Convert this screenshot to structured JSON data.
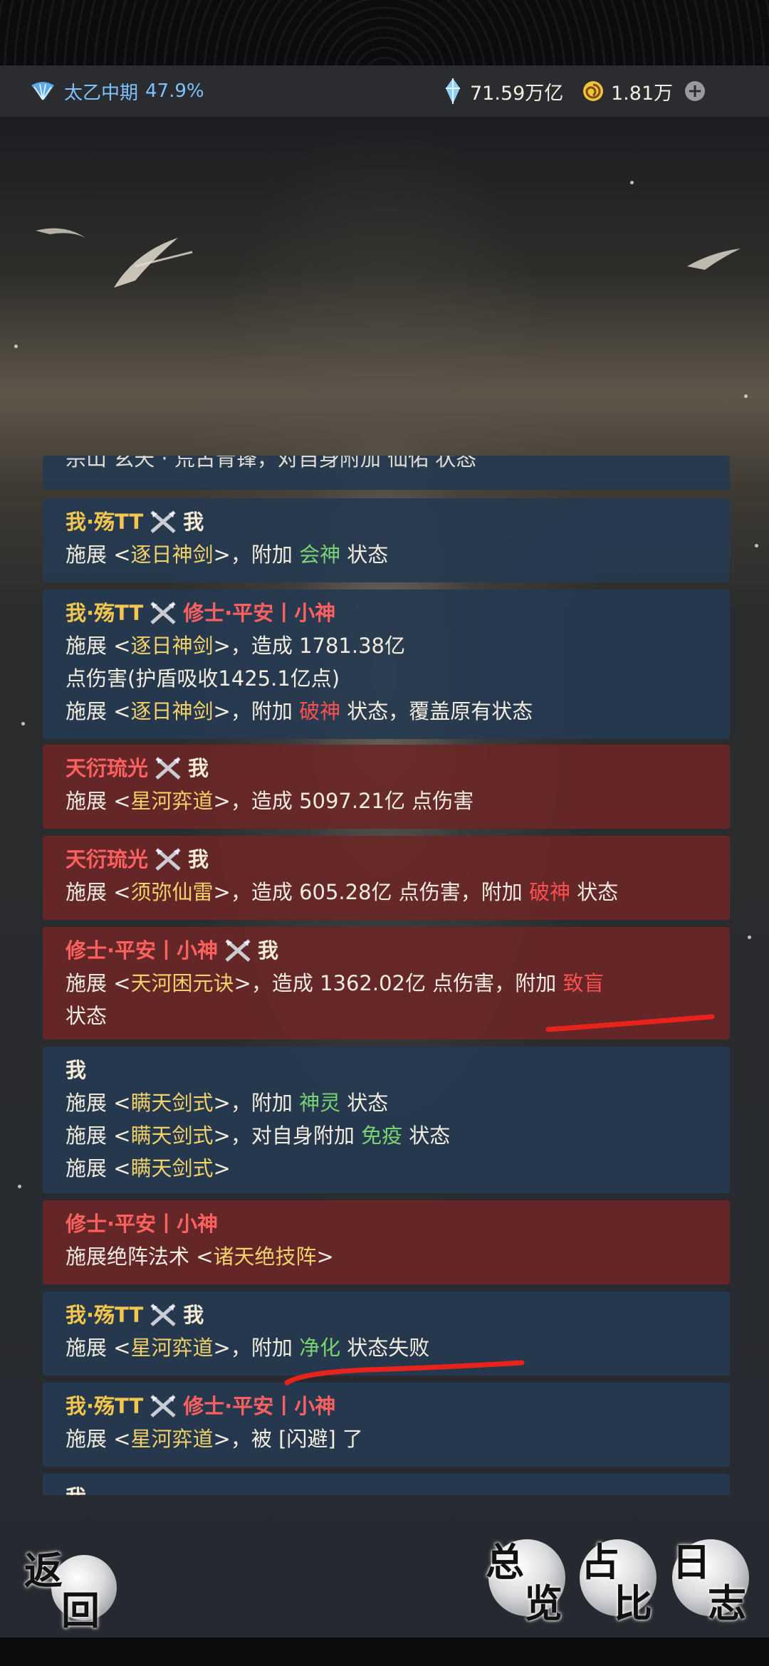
{
  "status": {
    "realm_name": "太乙中期",
    "realm_progress": "47.9%",
    "spirit_stones": "71.59万亿",
    "currency": "1.81万",
    "plus_label": "+"
  },
  "log": {
    "partial_top": "宗山 玄天 · 荒古青锋，对自身附加 仙佑 状态",
    "entries": [
      {
        "header": {
          "left": "我·殇TT",
          "right": "我"
        },
        "lines": [
          {
            "a": "施展 <",
            "skill": "逐日神剑",
            "b": ">，附加 ",
            "eff": "会神",
            "c": " 状态"
          }
        ]
      },
      {
        "header": {
          "left": "我·殇TT",
          "right": "修士·平安丨小神"
        },
        "l1": {
          "a": "施展 <",
          "skill": "逐日神剑",
          "b": ">，造成 1781.38亿"
        },
        "l2": "点伤害(护盾吸收1425.1亿点)",
        "l3": {
          "a": "施展 <",
          "skill": "逐日神剑",
          "b": ">，附加 ",
          "eff": "破神",
          "c": " 状态，覆盖原有状态"
        }
      },
      {
        "header": {
          "left": "天衍琉光",
          "right": "我"
        },
        "l1": {
          "a": "施展 <",
          "skill": "星河弈道",
          "b": ">，造成 5097.21亿 点伤害"
        }
      },
      {
        "header": {
          "left": "天衍琉光",
          "right": "我"
        },
        "l1": {
          "a": "施展 <",
          "skill": "须弥仙雷",
          "b": ">，造成 605.28亿 点伤害，附加 ",
          "eff": "破神",
          "c": " 状态"
        }
      },
      {
        "header": {
          "left": "修士·平安丨小神",
          "right": "我"
        },
        "l1": {
          "a": "施展 <",
          "skill": "天河困元诀",
          "b": ">，造成 1362.02亿 点伤害，附加 ",
          "eff": "致盲"
        },
        "l2": "状态"
      },
      {
        "header": {
          "left": "我"
        },
        "l1": {
          "a": "施展 <",
          "skill": "瞒天剑式",
          "b": ">，附加 ",
          "eff": "神灵",
          "c": " 状态"
        },
        "l2": {
          "a": "施展 <",
          "skill": "瞒天剑式",
          "b": ">，对自身附加 ",
          "eff": "免疫",
          "c": " 状态"
        },
        "l3": {
          "a": "施展 <",
          "skill": "瞒天剑式",
          "b": ">"
        }
      },
      {
        "header": {
          "left": "修士·平安丨小神"
        },
        "l1": {
          "a": "施展绝阵法术 <",
          "skill": "诸天绝技阵",
          "b": ">"
        }
      },
      {
        "header": {
          "left": "我·殇TT",
          "right": "我"
        },
        "l1": {
          "a": "施展 <",
          "skill": "星河弈道",
          "b": ">，附加 ",
          "eff": "净化",
          "c": " 状态失败"
        }
      },
      {
        "header": {
          "left": "我·殇TT",
          "right": "修士·平安丨小神"
        },
        "l1": {
          "a": "施展 <",
          "skill": "星河弈道",
          "b": ">，被 [闪避] 了"
        }
      },
      {
        "header": {
          "left": "我"
        }
      }
    ]
  },
  "buttons": {
    "back": [
      "返",
      "回"
    ],
    "overview": [
      "总",
      "览"
    ],
    "ratio": [
      "占",
      "比"
    ],
    "journal": [
      "日",
      "志"
    ]
  },
  "colors": {
    "blue_entry": "#263a50",
    "red_entry": "#6c2626",
    "gold": "#f3c64e",
    "enemy_red": "#ff6060",
    "buff_green": "#78d472",
    "annotation": "#e8231c"
  }
}
